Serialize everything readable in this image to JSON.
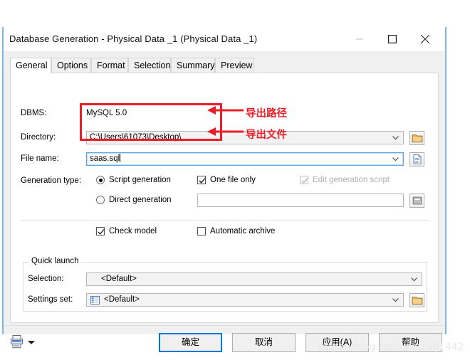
{
  "window": {
    "title": "Database Generation - Physical Data _1 (Physical Data _1)",
    "controls": {
      "minimize": "minimize-button",
      "maximize": "maximize-button",
      "close": "close-button"
    }
  },
  "tabs": [
    {
      "label": "General",
      "active": true
    },
    {
      "label": "Options",
      "active": false
    },
    {
      "label": "Format",
      "active": false
    },
    {
      "label": "Selection",
      "active": false
    },
    {
      "label": "Summary",
      "active": false
    },
    {
      "label": "Preview",
      "active": false
    }
  ],
  "general": {
    "dbms_label": "DBMS:",
    "dbms_value": "MySQL 5.0",
    "directory_label": "Directory:",
    "directory_value": "C:\\Users\\61073\\Desktop\\",
    "file_name_label": "File name:",
    "file_name_value": "saas.sql",
    "generation_type_label": "Generation type:",
    "script_generation_label": "Script generation",
    "script_generation_checked": true,
    "direct_generation_label": "Direct generation",
    "direct_generation_checked": false,
    "direct_generation_value": "",
    "one_file_only_label": "One file only",
    "one_file_only_checked": true,
    "edit_generation_script_label": "Edit generation script",
    "edit_generation_script_checked": true,
    "edit_generation_script_disabled": true,
    "check_model_label": "Check model",
    "check_model_checked": true,
    "automatic_archive_label": "Automatic archive",
    "automatic_archive_checked": false
  },
  "quick_launch": {
    "group_title": "Quick launch",
    "selection_label": "Selection:",
    "selection_value": "<Default>",
    "settings_set_label": "Settings set:",
    "settings_set_value": "<Default>"
  },
  "footer": {
    "ok_label": "确定",
    "cancel_label": "取消",
    "apply_label": "应用(A)",
    "help_label": "帮助"
  },
  "annotations": {
    "directory_note": "导出路径",
    "file_note": "导出文件",
    "color": "#ee1c25"
  },
  "watermark": "https://blog.csdn.net/wlj1442"
}
